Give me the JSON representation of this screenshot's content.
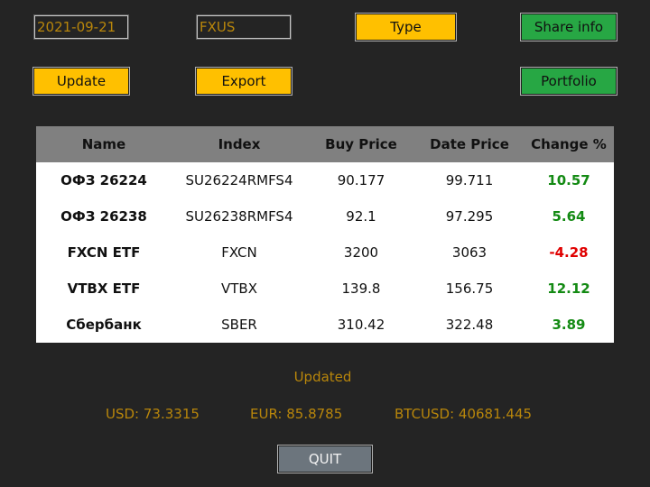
{
  "controls": {
    "date_value": "2021-09-21",
    "ticker_value": "FXUS",
    "type_label": "Type",
    "share_info_label": "Share info",
    "update_label": "Update",
    "export_label": "Export",
    "portfolio_label": "Portfolio"
  },
  "table": {
    "headers": [
      "Name",
      "Index",
      "Buy Price",
      "Date Price",
      "Change %"
    ],
    "rows": [
      {
        "name": "ОФЗ 26224",
        "index": "SU26224RMFS4",
        "buy_price": "90.177",
        "date_price": "99.711",
        "change": "10.57"
      },
      {
        "name": "ОФЗ 26238",
        "index": "SU26238RMFS4",
        "buy_price": "92.1",
        "date_price": "97.295",
        "change": "5.64"
      },
      {
        "name": "FXCN ETF",
        "index": "FXCN",
        "buy_price": "3200",
        "date_price": "3063",
        "change": "-4.28"
      },
      {
        "name": "VTBX ETF",
        "index": "VTBX",
        "buy_price": "139.8",
        "date_price": "156.75",
        "change": "12.12"
      },
      {
        "name": "Сбербанк",
        "index": "SBER",
        "buy_price": "310.42",
        "date_price": "322.48",
        "change": "3.89"
      }
    ]
  },
  "status": {
    "updated_text": "Updated",
    "usd": "USD: 73.3315",
    "eur": "EUR: 85.8785",
    "btc": "BTCUSD: 40681.445"
  },
  "footer": {
    "quit_label": "QUIT"
  },
  "colors": {
    "background": "#242424",
    "accent_yellow": "#ffc000",
    "accent_green": "#27a744",
    "status_text": "#b8860b",
    "positive": "#138a13",
    "negative": "#e00000",
    "header_gray": "#808080"
  }
}
